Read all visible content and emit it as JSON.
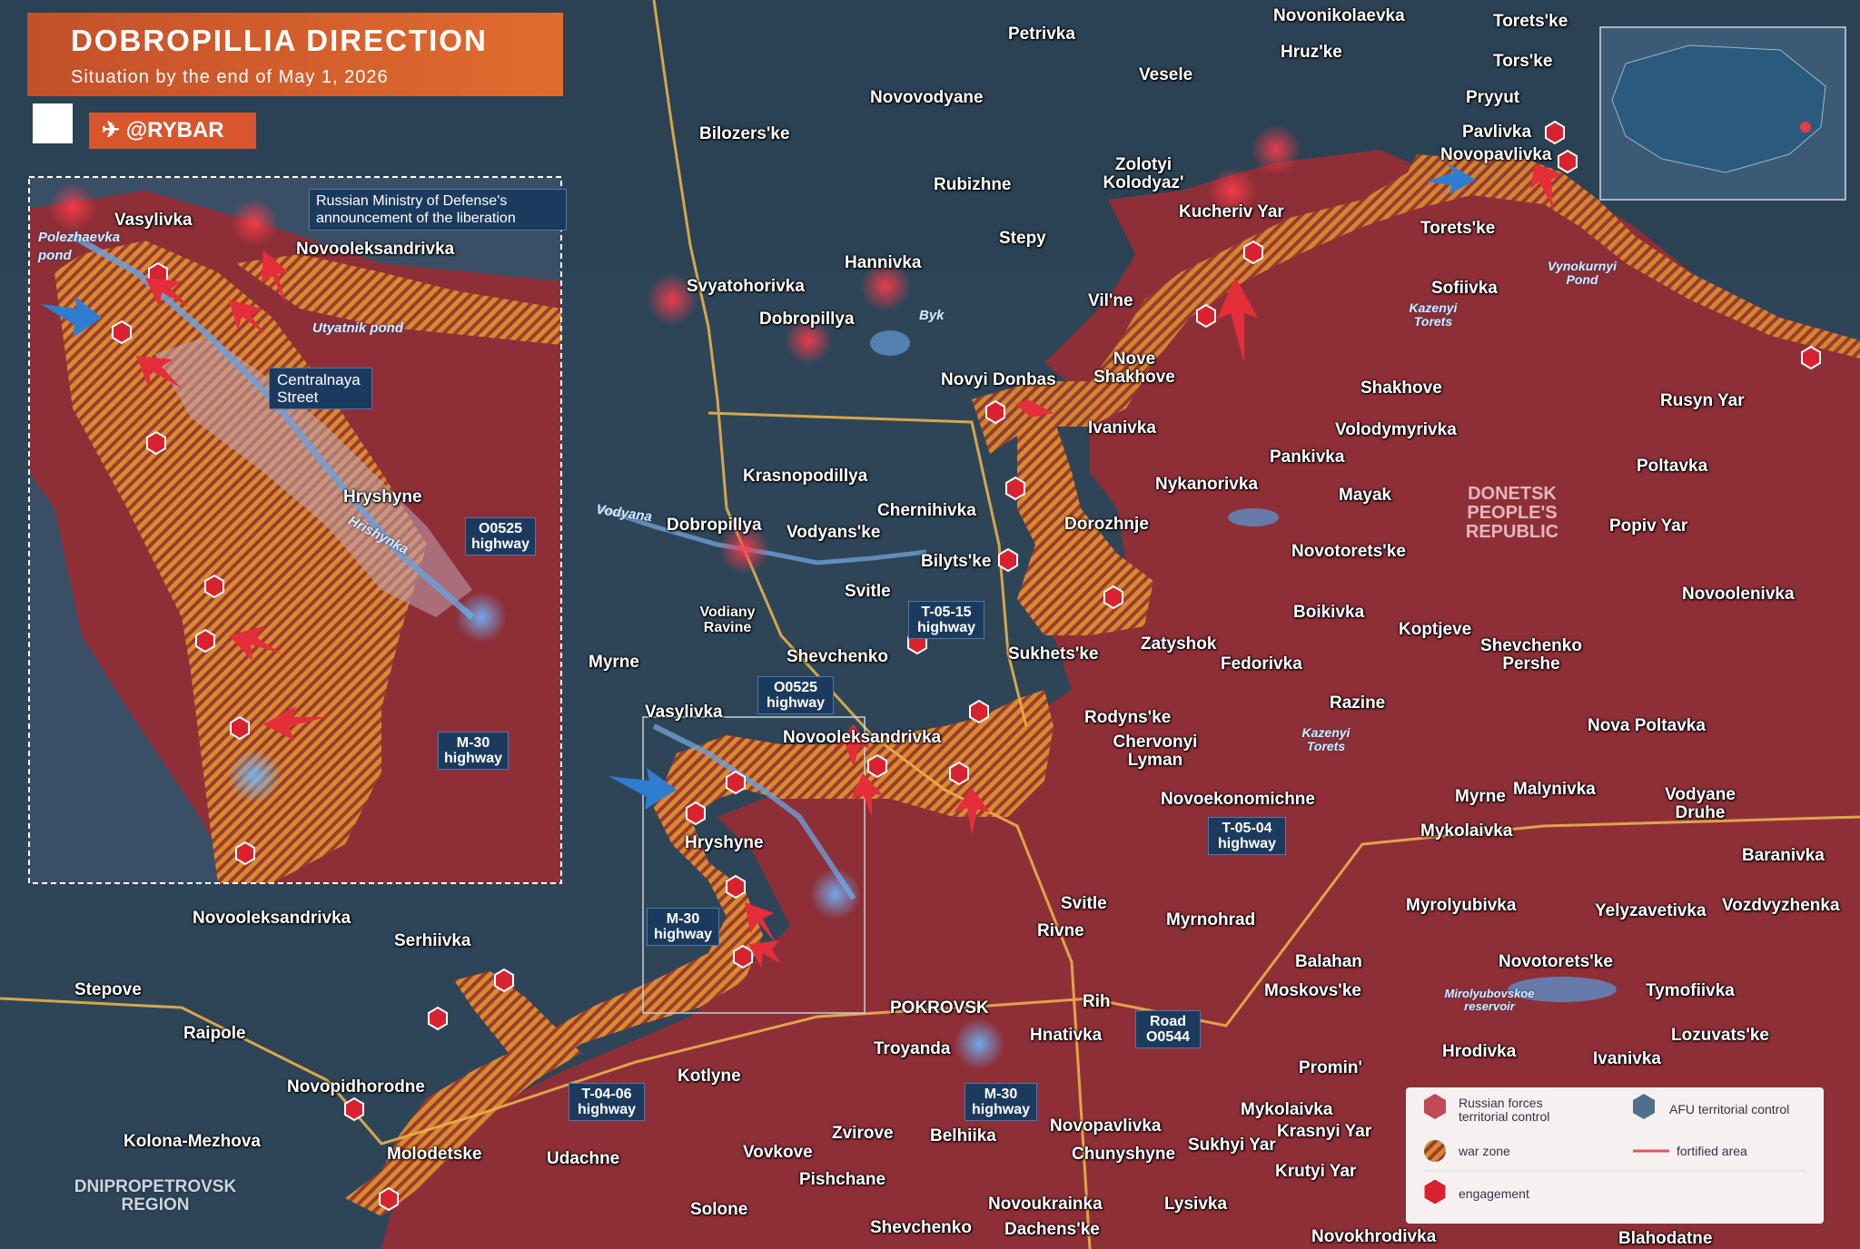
{
  "header": {
    "title": "DOBROPILLIA DIRECTION",
    "subtitle": "Situation by the end of May 1, 2026",
    "handle": "@RYBAR"
  },
  "inset": {
    "note": "Russian Ministry of Defense's announcement of the liberation",
    "street": "Centralnaya Street",
    "labels": {
      "vasylivka": "Vasylivka",
      "novooleksandrivka": "Novooleksandrivka",
      "polezhaevka": "Polezhaevka pond",
      "utyatnik": "Utyatnik pond",
      "hryshyne": "Hryshyne",
      "hrishynka": "Hrishynka",
      "o0525": "O0525 highway",
      "m30": "M-30 highway"
    }
  },
  "map": {
    "towns": {
      "novonikolaevka": "Novonikolaevka",
      "toretske_top": "Torets'ke",
      "petrivka": "Petrivka",
      "hruzke": "Hruz'ke",
      "vesele": "Vesele",
      "torske": "Tors'ke",
      "novovodyane": "Novovodyane",
      "pryyut": "Pryyut",
      "bilozerske": "Bilozers'ke",
      "pavlivka": "Pavlivka",
      "novopavlivka_top": "Novopavlivka",
      "zolotyi": "Zolotyi Kolodyaz'",
      "rubizhne": "Rubizhne",
      "kucheriv": "Kucheriv Yar",
      "toretske2": "Torets'ke",
      "stepy": "Stepy",
      "hannivka": "Hannivka",
      "sofiivka": "Sofiivka",
      "svyatohorivka": "Svyatohorivka",
      "vilne": "Vil'ne",
      "dobropillya_n": "Dobropillya",
      "nove_shakhove": "Nove Shakhove",
      "shakhove": "Shakhove",
      "novyi_donbas": "Novyi Donbas",
      "rusyn_yar": "Rusyn Yar",
      "ivanivka": "Ivanivka",
      "volodymyrivka": "Volodymyrivka",
      "pankivka": "Pankivka",
      "poltavka": "Poltavka",
      "krasnopodillya": "Krasnopodillya",
      "nykanorivka": "Nykanorivka",
      "mayak": "Mayak",
      "chernihivka": "Chernihivka",
      "dobropillya": "Dobropillya",
      "vodyanske": "Vodyans'ke",
      "dorozhnje": "Dorozhnje",
      "popiv_yar": "Popiv Yar",
      "bilytske": "Bilyts'ke",
      "novotoretske": "Novotorets'ke",
      "svitle": "Svitle",
      "boikivka": "Boikivka",
      "novoolenivka": "Novoolenivka",
      "zatyshok": "Zatyshok",
      "koptjeve": "Koptjeve",
      "shevchenko_pershe": "Shevchenko Pershe",
      "shevchenko": "Shevchenko",
      "sukhetske": "Sukhets'ke",
      "fedorivka": "Fedorivka",
      "myrne_w": "Myrne",
      "razine": "Razine",
      "vasylivka": "Vasylivka",
      "rodynske": "Rodyns'ke",
      "novooleksandrivka": "Novooleksandrivka",
      "chervonyi_lyman": "Chervonyi Lyman",
      "nova_poltavka": "Nova Poltavka",
      "myrne_e": "Myrne",
      "malynivka": "Malynivka",
      "novoekonomichne": "Novoekonomichne",
      "vodyane_druhe": "Vodyane Druhe",
      "hryshyne": "Hryshyne",
      "mykolaivka": "Mykolaivka",
      "baranivka": "Baranivka",
      "novooleksandrivka_w": "Novooleksandrivka",
      "svitle2": "Svitle",
      "myrnohrad": "Myrnohrad",
      "myrolyubivka": "Myrolyubivka",
      "yelyzavetivka": "Yelyzavetivka",
      "vozdvyzhenka": "Vozdvyzhenka",
      "serhiivka": "Serhiivka",
      "rivne": "Rivne",
      "balahan": "Balahan",
      "novotoretske2": "Novotorets'ke",
      "stepove": "Stepove",
      "moskovske": "Moskovs'ke",
      "tymofiivka": "Tymofiivka",
      "pokrovsk": "POKROVSK",
      "rih": "Rih",
      "raipole": "Raipole",
      "troyanda": "Troyanda",
      "hnativka": "Hnatіvka",
      "lozuvatske": "Lozuvats'ke",
      "hrodivka": "Hrodivka",
      "ivanivka2": "Ivanivka",
      "promin": "Promin'",
      "kotlyne": "Kotlyne",
      "novopidhorodne": "Novopidhorodne",
      "novopavlivka": "Novopavlivka",
      "mykolaivka2": "Mykolaivka",
      "krasnyi_yar": "Krasnyi Yar",
      "zvirove": "Zvirove",
      "chunyshyne": "Chunyshyne",
      "sukhyi_yar": "Sukhyi Yar",
      "kolona": "Kolona-Mezhova",
      "vovkove": "Vovkove",
      "belhiika": "Belhiika",
      "molodetske": "Molodetske",
      "udachne": "Udachne",
      "krutyi_yar": "Krutyi Yar",
      "pishchane": "Pishchane",
      "solone": "Solone",
      "novoukrainka": "Novoukrainka",
      "lysivka": "Lysivka",
      "shevchenko_s": "Shevchenko",
      "dachenske": "Dachens'ke",
      "novokhrodivka": "Novokhrodivka",
      "blahodatne": "Blahodatne"
    },
    "water": {
      "byk": "Byk",
      "vodyana": "Vodyana",
      "kazenyi_torets": "Kazenyi Torets",
      "kazenyi_torets2": "Kazenyi Torets",
      "vynokurnyi": "Vynokurnyi Pond",
      "myrolyubovskoe": "Mirolyubovskoe reservoir"
    },
    "ravine": "Vodiany Ravine",
    "region_dnipro": "DNIPROPETROVSK REGION",
    "region_dpr": "DONETSK PEOPLE'S REPUBLIC",
    "highways": {
      "o0525": "O0525 highway",
      "t0515": "T-05-15 highway",
      "m30_a": "M-30 highway",
      "t0504": "T-05-04 highway",
      "t0406": "T-04-06 highway",
      "m30_b": "M-30 highway",
      "road0544": "Road O0544"
    }
  },
  "legend": {
    "russian": "Russian forces territorial control",
    "afu": "AFU territorial control",
    "warzone": "war zone",
    "fortified": "fortified area",
    "engagement": "engagement"
  },
  "colors": {
    "russian_fill": "#8e2f37",
    "afu_fill": "#2f4a60",
    "warzone": "#e09a3a",
    "header": "#d9552d",
    "road": "#e9b14a"
  }
}
